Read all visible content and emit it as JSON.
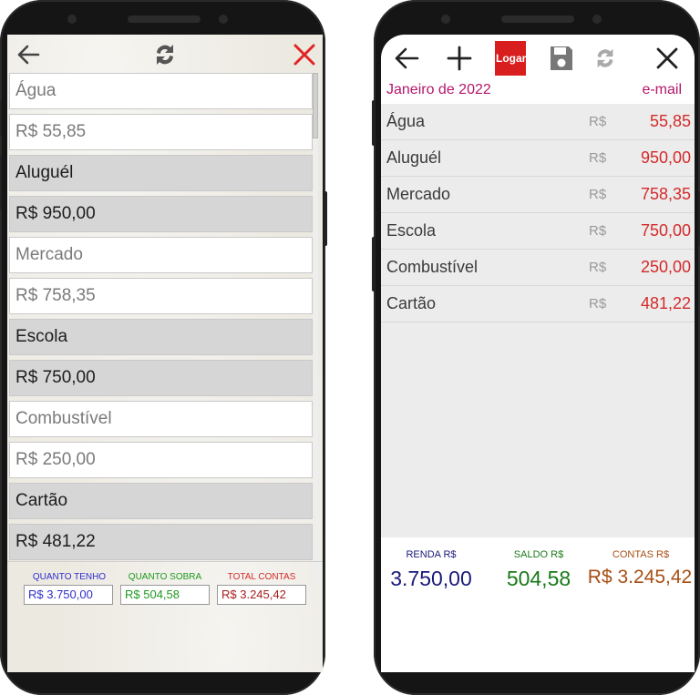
{
  "left_app": {
    "toolbar": {
      "back_icon": "arrow-left-icon",
      "refresh_icon": "refresh-icon",
      "close_icon": "close-x-icon"
    },
    "rows": [
      {
        "text": "Água",
        "style": "white"
      },
      {
        "text": "R$ 55,85",
        "style": "white"
      },
      {
        "text": "Aluguél",
        "style": "gray"
      },
      {
        "text": "R$ 950,00",
        "style": "gray"
      },
      {
        "text": "Mercado",
        "style": "white"
      },
      {
        "text": "R$ 758,35",
        "style": "white"
      },
      {
        "text": "Escola",
        "style": "gray"
      },
      {
        "text": "R$ 750,00",
        "style": "gray"
      },
      {
        "text": "Combustível",
        "style": "white"
      },
      {
        "text": "R$ 250,00",
        "style": "white"
      },
      {
        "text": "Cartão",
        "style": "gray"
      },
      {
        "text": "R$ 481,22",
        "style": "gray"
      }
    ],
    "footer": {
      "quanto_tenho": {
        "label": "QUANTO TENHO",
        "value": "R$ 3.750,00",
        "color": "#2d2dd0"
      },
      "quanto_sobra": {
        "label": "QUANTO SOBRA",
        "value": "R$ 504,58",
        "color": "#1f9a1f"
      },
      "total_contas": {
        "label": "TOTAL CONTAS",
        "value": "R$ 3.245,42",
        "color": "#d42a2a"
      }
    }
  },
  "right_app": {
    "toolbar": {
      "back_icon": "arrow-left-icon",
      "add_icon": "plus-icon",
      "login_label": "Logar",
      "save_icon": "floppy-disk-icon",
      "refresh_icon": "refresh-icon",
      "close_icon": "close-x-icon"
    },
    "month_label": "Janeiro de 2022",
    "email_link": "e-mail",
    "currency": "R$",
    "items": [
      {
        "name": "Água",
        "value": "55,85"
      },
      {
        "name": "Aluguél",
        "value": "950,00"
      },
      {
        "name": "Mercado",
        "value": "758,35"
      },
      {
        "name": "Escola",
        "value": "750,00"
      },
      {
        "name": "Combustível",
        "value": "250,00"
      },
      {
        "name": "Cartão",
        "value": "481,22"
      }
    ],
    "summary": {
      "renda": {
        "label": "RENDA R$",
        "value": "3.750,00",
        "color": "#1a1a7a"
      },
      "saldo": {
        "label": "SALDO R$",
        "value": "504,58",
        "color": "#1a7a1a"
      },
      "contas": {
        "label": "CONTAS R$",
        "value": "R$ 3.245,42",
        "color": "#a84e14"
      }
    }
  }
}
